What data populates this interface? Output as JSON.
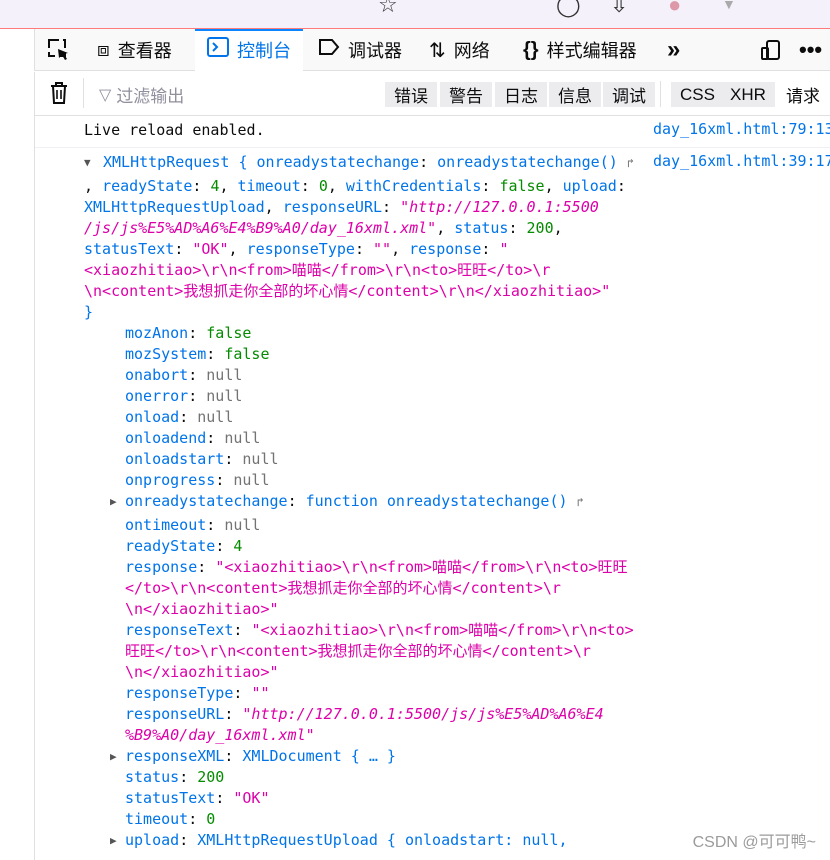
{
  "toolbar": {
    "tabs": [
      {
        "label": "查看器",
        "icon": "inspector-icon"
      },
      {
        "label": "控制台",
        "icon": "console-icon",
        "selected": true
      },
      {
        "label": "调试器",
        "icon": "debugger-icon"
      },
      {
        "label": "网络",
        "icon": "network-icon"
      },
      {
        "label": "样式编辑器",
        "icon": "style-editor-icon"
      }
    ]
  },
  "filter": {
    "placeholder": "过滤输出",
    "levels": [
      "错误",
      "警告",
      "日志",
      "信息",
      "调试"
    ],
    "types": [
      "CSS",
      "XHR",
      "请求"
    ]
  },
  "console": {
    "line1": {
      "text": "Live reload enabled.",
      "source": "day_16xml.html:79:13"
    },
    "line2": {
      "source": "day_16xml.html:39:17"
    }
  },
  "object": {
    "className": "XMLHttpRequest",
    "preview": {
      "onreadystatechange": "onreadystatechange()",
      "readyState": "4",
      "timeout": "0",
      "withCredentials": "false",
      "upload": "XMLHttpRequestUpload",
      "responseURL_l1": "\"http://127.0.0.1:5500",
      "responseURL_l2": "/js/js%E5%AD%A6%E4%B9%A0/day_16xml.xml\"",
      "status": "200",
      "statusText": "\"OK\"",
      "responseType": "\"\"",
      "response_l1": "\"",
      "response_l2": "<xiaozhitiao>\\r\\n<from>喵喵</from>\\r\\n<to>旺旺</to>\\r",
      "response_l3": "\\n<content>我想抓走你全部的坏心情</content>\\r\\n</xiaozhitiao>\""
    },
    "props": {
      "mozAnon": "false",
      "mozSystem": "false",
      "onabort": "null",
      "onerror": "null",
      "onload": "null",
      "onloadend": "null",
      "onloadstart": "null",
      "onprogress": "null",
      "onreadystatechange": "function onreadystatechange()",
      "ontimeout": "null",
      "readyState": "4",
      "response_l1": "\"<xiaozhitiao>\\r\\n<from>喵喵</from>\\r\\n<to>旺旺",
      "response_l2": "</to>\\r\\n<content>我想抓走你全部的坏心情</content>\\r",
      "response_l3": "\\n</xiaozhitiao>\"",
      "responseText_l1": "\"<xiaozhitiao>\\r\\n<from>喵喵</from>\\r\\n<to>",
      "responseText_l2": "旺旺</to>\\r\\n<content>我想抓走你全部的坏心情</content>\\r",
      "responseText_l3": "\\n</xiaozhitiao>\"",
      "responseType": "\"\"",
      "responseURL_l1": "\"http://127.0.0.1:5500/js/js%E5%AD%A6%E4",
      "responseURL_l2": "%B9%A0/day_16xml.xml\"",
      "responseXML": "XMLDocument",
      "status": "200",
      "statusText": "\"OK\"",
      "timeout": "0",
      "upload": "XMLHttpRequestUpload",
      "upload_preview": "onloadstart: null,"
    }
  },
  "watermark": "CSDN @可可鸭~"
}
